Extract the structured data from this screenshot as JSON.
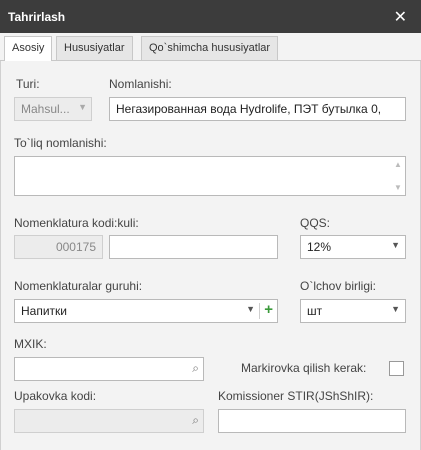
{
  "window": {
    "title": "Tahrirlash",
    "close_glyph": "✕"
  },
  "tabs": [
    {
      "label": "Asosiy",
      "active": true
    },
    {
      "label": "Hususiyatlar",
      "active": false
    },
    {
      "label": "Qo`shimcha hususiyatlar",
      "active": false
    }
  ],
  "form": {
    "turi": {
      "label": "Turi:",
      "value": "Mahsul..."
    },
    "nomlanishi": {
      "label": "Nomlanishi:",
      "value": "Негазированная вода Hydrolife, ПЭТ бутылка 0,"
    },
    "full_name": {
      "label": "To`liq nomlanishi:",
      "value": ""
    },
    "nomenklatura_code": {
      "label": "Nomenklatura kodi:kuli:",
      "code_value": "000175",
      "value": ""
    },
    "qqs": {
      "label": "QQS:",
      "value": "12%"
    },
    "group": {
      "label": "Nomenklaturalar guruhi:",
      "value": "Напитки"
    },
    "unit": {
      "label": "O`lchov birligi:",
      "value": "шт"
    },
    "mxik": {
      "label": "MXIK:",
      "value": ""
    },
    "marking": {
      "label": "Markirovka qilish kerak:",
      "checked": false
    },
    "packaging": {
      "label": "Upakovka kodi:",
      "value": ""
    },
    "commissioner": {
      "label": "Komissioner STIR(JShShIR):",
      "value": ""
    }
  },
  "icons": {
    "dropdown": "chevron-down-icon",
    "search": "search-icon",
    "add": "plus-icon",
    "close": "close-icon"
  }
}
